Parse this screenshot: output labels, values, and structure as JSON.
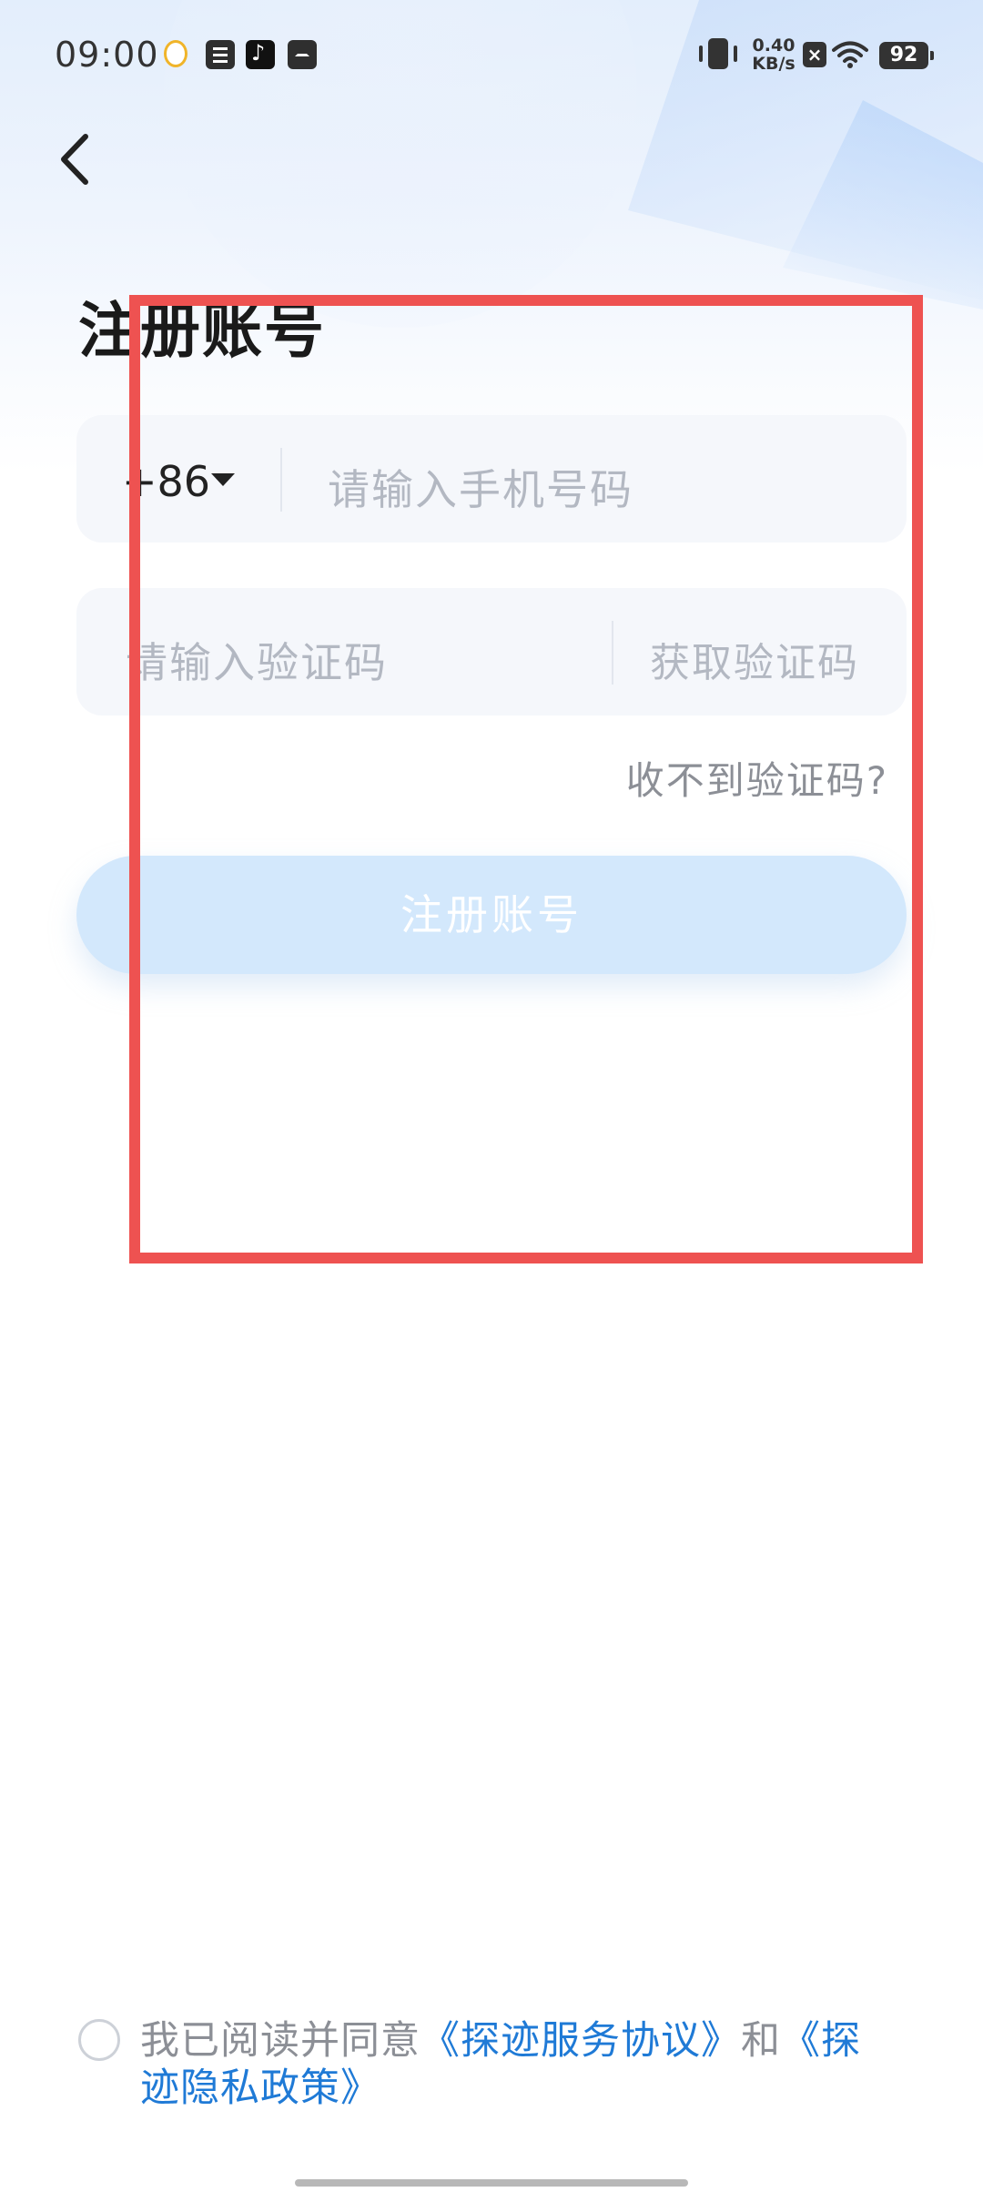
{
  "status_bar": {
    "time": "09:00",
    "network_speed_value": "0.40",
    "network_speed_unit": "KB/s",
    "battery": "92",
    "icons": [
      "qq-icon",
      "document-icon",
      "tiktok-icon",
      "mail-icon",
      "vibrate-icon",
      "no-sim-icon",
      "wifi-icon",
      "battery-icon"
    ]
  },
  "header": {
    "back_icon": "chevron-left-icon",
    "title": "注册账号"
  },
  "form": {
    "country_code": "+86",
    "phone_placeholder": "请输入手机号码",
    "code_placeholder": "请输入验证码",
    "get_code_label": "获取验证码",
    "cant_receive_label": "收不到验证码?",
    "submit_label": "注册账号"
  },
  "agreement": {
    "prefix": "我已阅读并同意",
    "service_link": "《探迹服务协议》",
    "connector": "和",
    "privacy_link": "《探迹隐私政策》"
  },
  "colors": {
    "link": "#1f7ad6",
    "button_disabled": "#d3e8fc",
    "highlight": "#ee5251"
  }
}
